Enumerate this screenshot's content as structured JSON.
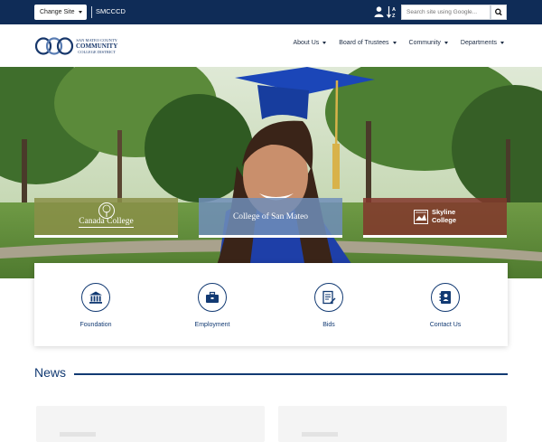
{
  "topbar": {
    "change_site_label": "Change Site",
    "site_name": "SMCCCD",
    "search_placeholder": "Search site using Google..."
  },
  "logo": {
    "line_top": "SAN MATEO COUNTY",
    "line_main": "COMMUNITY",
    "line_bottom": "COLLEGE DISTRICT"
  },
  "nav": [
    {
      "label": "About Us"
    },
    {
      "label": "Board of Trustees"
    },
    {
      "label": "Community"
    },
    {
      "label": "Departments"
    }
  ],
  "colleges": [
    {
      "label": "Canada College"
    },
    {
      "label": "College of San Mateo"
    },
    {
      "label_line1": "Skyline",
      "label_line2": "College"
    }
  ],
  "quick_links": [
    {
      "label": "Foundation",
      "icon": "bank-icon"
    },
    {
      "label": "Employment",
      "icon": "briefcase-icon"
    },
    {
      "label": "Bids",
      "icon": "document-pen-icon"
    },
    {
      "label": "Contact Us",
      "icon": "contact-book-icon"
    }
  ],
  "news": {
    "title": "News"
  },
  "colors": {
    "topbar": "#0f2c57",
    "brand_blue": "#123a73",
    "canada": "#8a8f48",
    "san_mateo": "#708eba",
    "skyline": "#83362c"
  }
}
